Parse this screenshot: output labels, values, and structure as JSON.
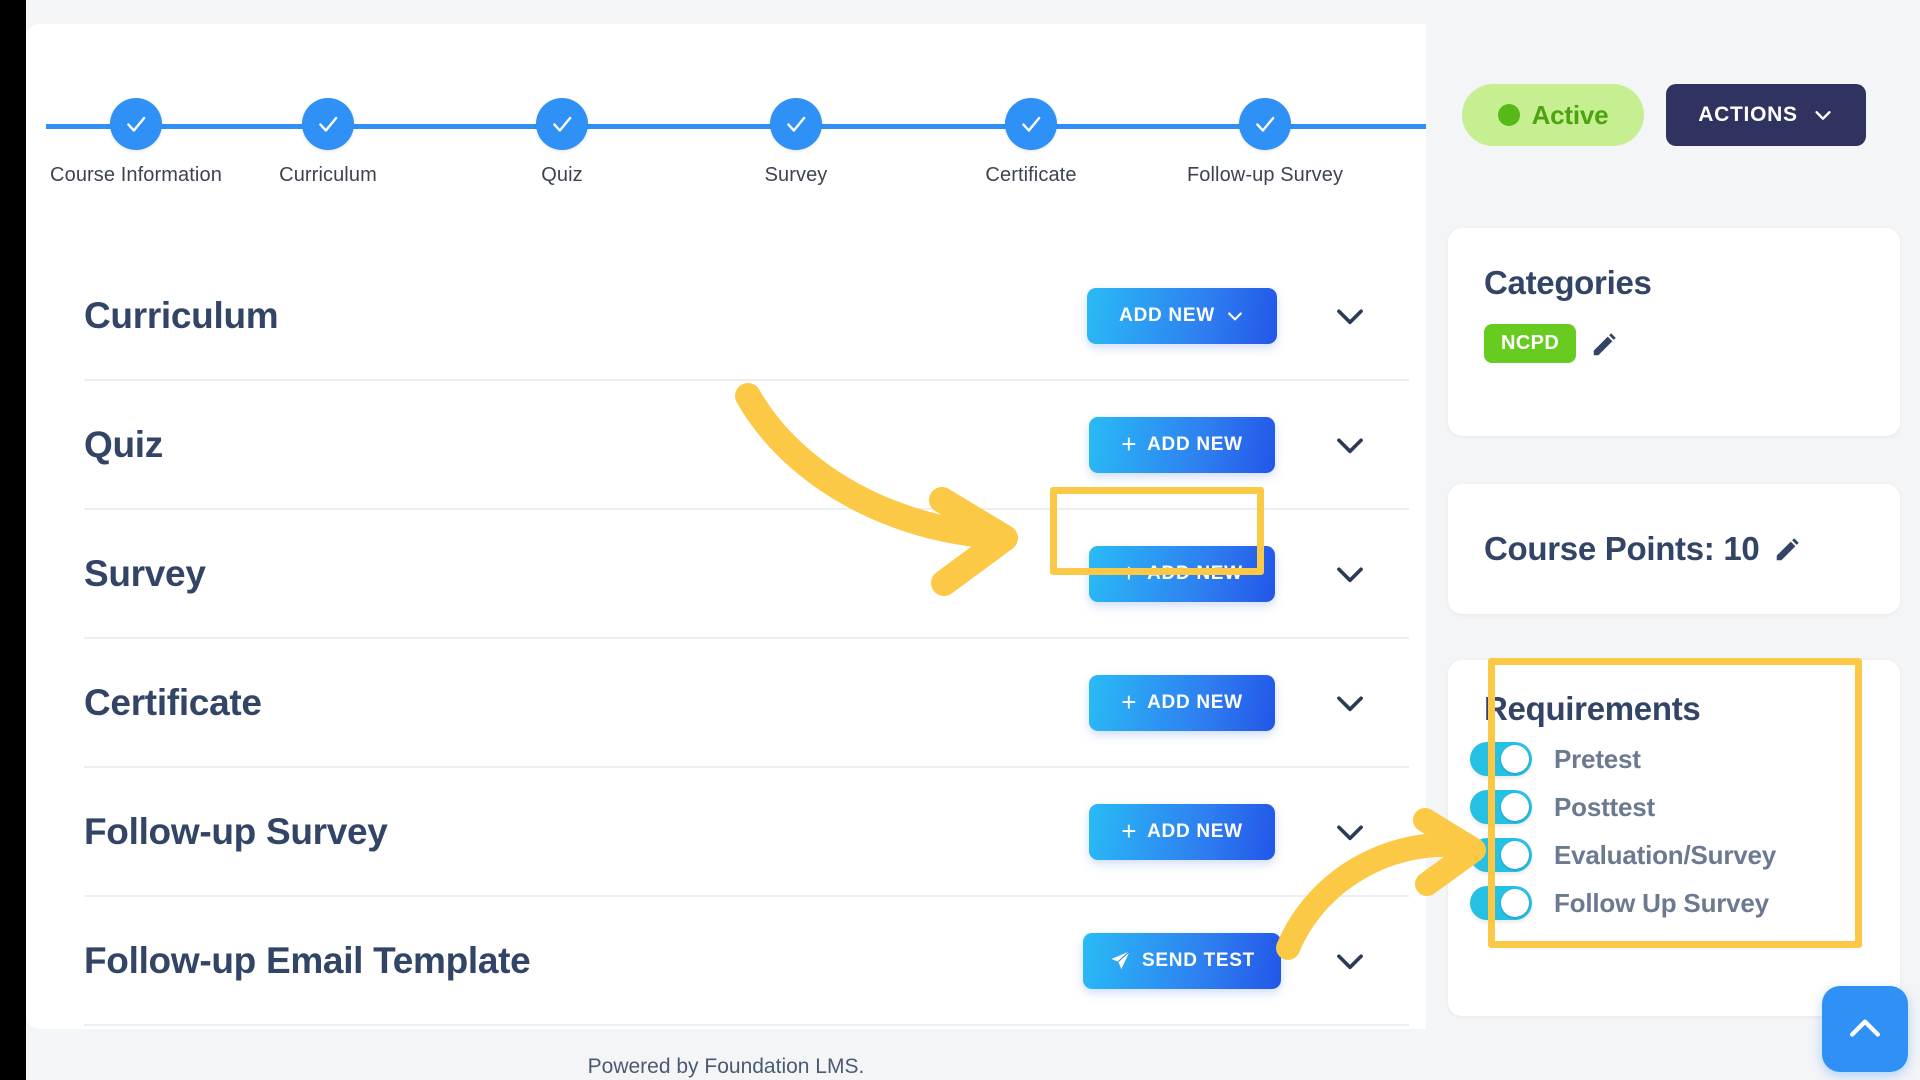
{
  "stepper": {
    "steps": [
      {
        "label": "Course Information",
        "state": "complete",
        "icon": "check-icon"
      },
      {
        "label": "Curriculum",
        "state": "complete",
        "icon": "check-icon"
      },
      {
        "label": "Quiz",
        "state": "complete",
        "icon": "check-icon"
      },
      {
        "label": "Survey",
        "state": "complete",
        "icon": "check-icon"
      },
      {
        "label": "Certificate",
        "state": "complete",
        "icon": "check-icon"
      },
      {
        "label": "Follow-up Survey",
        "state": "complete",
        "icon": "check-icon"
      }
    ],
    "line_color": "#2f90f5",
    "circle_color": "#2f90f5"
  },
  "sections": [
    {
      "title": "Curriculum",
      "action_label": "ADD NEW",
      "action_icon": "chevron-down-icon",
      "icon_position": "right",
      "highlighted": false
    },
    {
      "title": "Quiz",
      "action_label": "ADD NEW",
      "action_icon": "plus-icon",
      "icon_position": "left",
      "highlighted": false
    },
    {
      "title": "Survey",
      "action_label": "ADD NEW",
      "action_icon": "plus-icon",
      "icon_position": "left",
      "highlighted": true
    },
    {
      "title": "Certificate",
      "action_label": "ADD NEW",
      "action_icon": "plus-icon",
      "icon_position": "left",
      "highlighted": false
    },
    {
      "title": "Follow-up Survey",
      "action_label": "ADD NEW",
      "action_icon": "plus-icon",
      "icon_position": "left",
      "highlighted": false
    },
    {
      "title": "Follow-up Email Template",
      "action_label": "SEND TEST",
      "action_icon": "paper-plane-icon",
      "icon_position": "left",
      "highlighted": false
    }
  ],
  "sidebar": {
    "status_badge": {
      "label": "Active",
      "dot_color": "#56b819",
      "background": "#c6ef92",
      "text_color": "#4da212"
    },
    "actions_button": {
      "label": "ACTIONS",
      "icon": "chevron-down-icon",
      "background": "#30335f"
    },
    "categories": {
      "title": "Categories",
      "chips": [
        {
          "label": "NCPD",
          "color": "#67cc1f"
        }
      ],
      "edit_icon": "pencil-icon"
    },
    "course_points": {
      "label": "Course Points: 10",
      "edit_icon": "pencil-icon"
    },
    "requirements": {
      "title": "Requirements",
      "items": [
        {
          "label": "Pretest",
          "enabled": true
        },
        {
          "label": "Posttest",
          "enabled": true
        },
        {
          "label": "Evaluation/Survey",
          "enabled": true
        },
        {
          "label": "Follow Up Survey",
          "enabled": true
        }
      ],
      "toggle_on_color": "#27c0e5"
    }
  },
  "annotations": {
    "highlight_color": "#fbc946",
    "arrow_color": "#fbc946",
    "targets": [
      "survey-add-new-button",
      "requirements-panel"
    ]
  },
  "footer": {
    "text": "Powered by Foundation LMS."
  },
  "scroll_top_button": {
    "icon": "chevron-up-icon",
    "color": "#2f90f5"
  },
  "colors": {
    "page_background": "#f4f5f7",
    "card_background": "#ffffff",
    "heading_text": "#334566",
    "button_gradient_from": "#29bbf5",
    "button_gradient_to": "#2356e8"
  }
}
